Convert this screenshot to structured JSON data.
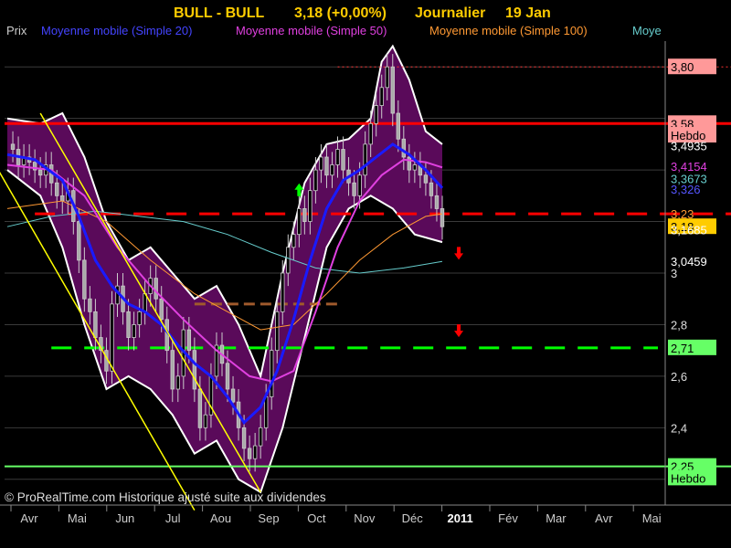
{
  "header": {
    "symbol": "BULL - BULL",
    "quote": "3,18 (+0,00%)",
    "period": "Journalier",
    "date": "19 Jan"
  },
  "legend": {
    "price": "Prix",
    "ma20": "Moyenne mobile (Simple 20)",
    "ma50": "Moyenne mobile (Simple 50)",
    "ma100": "Moyenne mobile (Simple 100)",
    "ma_cut": "Moye"
  },
  "watermark": "© ProRealTime.com Historique ajusté suite aux dividendes",
  "colors": {
    "background": "#000000",
    "band_fill": "#5a0a5a",
    "band_edge": "#ffffff",
    "ma20": "#1a1aff",
    "ma50": "#e040e0",
    "ma100": "#ff9933",
    "ma200": "#66cccc",
    "resistance": "#ff0000",
    "support": "#00ff00",
    "trendline": "#ffff00",
    "bronze": "#a05a2c"
  },
  "chart_data": {
    "type": "candlestick",
    "x_ticks": [
      "Avr",
      "Mai",
      "Jun",
      "Jul",
      "Aou",
      "Sep",
      "Oct",
      "Nov",
      "Déc",
      "2011",
      "Fév",
      "Mar",
      "Avr",
      "Mai"
    ],
    "y_ticks": [
      {
        "label": "3",
        "value": 3.0
      },
      {
        "label": "2,8",
        "value": 2.8
      },
      {
        "label": "2,6",
        "value": 2.6
      },
      {
        "label": "2,4",
        "value": 2.4
      }
    ],
    "ylim": [
      2.1,
      3.9
    ],
    "price_labels": [
      {
        "text": "3,80",
        "value": 3.8,
        "bg": "#ff9999",
        "fg": "#000000"
      },
      {
        "text": "3,58",
        "value": 3.58,
        "bg": "#ff9999",
        "fg": "#000000"
      },
      {
        "text": "Hebdo",
        "value": 3.535,
        "bg": "#ff9999",
        "fg": "#000000"
      },
      {
        "text": "3,4935",
        "value": 3.4935,
        "bg": "#000000",
        "fg": "#ffffff"
      },
      {
        "text": "3,4154",
        "value": 3.4154,
        "bg": "#000000",
        "fg": "#e040e0"
      },
      {
        "text": "3,3673",
        "value": 3.3673,
        "bg": "#000000",
        "fg": "#66cccc"
      },
      {
        "text": "3,326",
        "value": 3.326,
        "bg": "#000000",
        "fg": "#5555ff"
      },
      {
        "text": "3,23",
        "value": 3.23,
        "bg": "#000000",
        "fg": "#ff9933"
      },
      {
        "text": "3,18",
        "value": 3.18,
        "bg": "#ffcc00",
        "fg": "#000000"
      },
      {
        "text": "3,1685",
        "value": 3.1685,
        "bg": "#000000",
        "fg": "#ffffff"
      },
      {
        "text": "3,0459",
        "value": 3.0459,
        "bg": "#000000",
        "fg": "#ffffff"
      },
      {
        "text": "2,71",
        "value": 2.71,
        "bg": "#66ff66",
        "fg": "#000000"
      },
      {
        "text": "2,25",
        "value": 2.25,
        "bg": "#66ff66",
        "fg": "#000000"
      },
      {
        "text": "Hebdo",
        "value": 2.205,
        "bg": "#66ff66",
        "fg": "#000000"
      }
    ],
    "horizontal_levels": [
      {
        "name": "weekly-resistance",
        "value": 3.58,
        "style": "solid",
        "color": "#ff0000"
      },
      {
        "name": "dashed-resistance",
        "value": 3.23,
        "style": "dashed",
        "color": "#ff0000"
      },
      {
        "name": "dashed-support",
        "value": 2.71,
        "style": "dashed",
        "color": "#00ff00"
      },
      {
        "name": "weekly-support",
        "value": 2.25,
        "style": "solid",
        "color": "#66ff66"
      },
      {
        "name": "target-level",
        "value": 3.8,
        "style": "dotted",
        "color": "#ff3333"
      },
      {
        "name": "bronze-level",
        "value": 2.88,
        "style": "dashed",
        "color": "#a05a2c"
      }
    ],
    "price_series": [
      [
        0,
        3.5
      ],
      [
        1,
        3.48
      ],
      [
        2,
        3.42
      ],
      [
        3,
        3.45
      ],
      [
        4,
        3.43
      ],
      [
        5,
        3.4
      ],
      [
        6,
        3.38
      ],
      [
        7,
        3.42
      ],
      [
        8,
        3.35
      ],
      [
        9,
        3.3
      ],
      [
        10,
        3.28
      ],
      [
        11,
        3.32
      ],
      [
        12,
        3.2
      ],
      [
        13,
        3.05
      ],
      [
        14,
        2.9
      ],
      [
        15,
        2.85
      ],
      [
        16,
        2.75
      ],
      [
        17,
        2.7
      ],
      [
        18,
        2.62
      ],
      [
        19,
        2.88
      ],
      [
        20,
        2.95
      ],
      [
        21,
        2.85
      ],
      [
        22,
        2.75
      ],
      [
        23,
        2.8
      ],
      [
        24,
        2.85
      ],
      [
        25,
        2.92
      ],
      [
        26,
        2.98
      ],
      [
        27,
        2.9
      ],
      [
        28,
        2.82
      ],
      [
        29,
        2.7
      ],
      [
        30,
        2.55
      ],
      [
        31,
        2.6
      ],
      [
        32,
        2.78
      ],
      [
        33,
        2.7
      ],
      [
        34,
        2.55
      ],
      [
        35,
        2.4
      ],
      [
        36,
        2.45
      ],
      [
        37,
        2.6
      ],
      [
        38,
        2.72
      ],
      [
        39,
        2.65
      ],
      [
        40,
        2.55
      ],
      [
        41,
        2.5
      ],
      [
        42,
        2.4
      ],
      [
        43,
        2.32
      ],
      [
        44,
        2.28
      ],
      [
        45,
        2.33
      ],
      [
        46,
        2.4
      ],
      [
        47,
        2.52
      ],
      [
        48,
        2.7
      ],
      [
        49,
        2.85
      ],
      [
        50,
        3.0
      ],
      [
        51,
        3.1
      ],
      [
        52,
        3.15
      ],
      [
        53,
        3.25
      ],
      [
        54,
        3.2
      ],
      [
        55,
        3.32
      ],
      [
        56,
        3.4
      ],
      [
        57,
        3.45
      ],
      [
        58,
        3.38
      ],
      [
        59,
        3.42
      ],
      [
        60,
        3.48
      ],
      [
        61,
        3.4
      ],
      [
        62,
        3.35
      ],
      [
        63,
        3.3
      ],
      [
        64,
        3.38
      ],
      [
        65,
        3.5
      ],
      [
        66,
        3.58
      ],
      [
        67,
        3.65
      ],
      [
        68,
        3.72
      ],
      [
        69,
        3.8
      ],
      [
        70,
        3.62
      ],
      [
        71,
        3.52
      ],
      [
        72,
        3.45
      ],
      [
        73,
        3.4
      ],
      [
        74,
        3.42
      ],
      [
        75,
        3.38
      ],
      [
        76,
        3.35
      ],
      [
        77,
        3.3
      ],
      [
        78,
        3.25
      ],
      [
        79,
        3.18
      ]
    ],
    "ma20": [
      [
        0,
        3.46
      ],
      [
        5,
        3.44
      ],
      [
        10,
        3.36
      ],
      [
        13,
        3.22
      ],
      [
        16,
        3.05
      ],
      [
        19,
        2.95
      ],
      [
        22,
        2.88
      ],
      [
        25,
        2.85
      ],
      [
        28,
        2.8
      ],
      [
        31,
        2.72
      ],
      [
        34,
        2.65
      ],
      [
        37,
        2.6
      ],
      [
        40,
        2.52
      ],
      [
        43,
        2.42
      ],
      [
        46,
        2.48
      ],
      [
        49,
        2.62
      ],
      [
        52,
        2.82
      ],
      [
        55,
        3.05
      ],
      [
        58,
        3.25
      ],
      [
        61,
        3.36
      ],
      [
        64,
        3.4
      ],
      [
        67,
        3.45
      ],
      [
        70,
        3.5
      ],
      [
        73,
        3.46
      ],
      [
        76,
        3.4
      ],
      [
        79,
        3.33
      ]
    ],
    "ma50": [
      [
        0,
        3.42
      ],
      [
        8,
        3.4
      ],
      [
        14,
        3.3
      ],
      [
        20,
        3.1
      ],
      [
        26,
        2.95
      ],
      [
        32,
        2.82
      ],
      [
        38,
        2.7
      ],
      [
        44,
        2.6
      ],
      [
        48,
        2.58
      ],
      [
        52,
        2.62
      ],
      [
        56,
        2.85
      ],
      [
        60,
        3.1
      ],
      [
        64,
        3.28
      ],
      [
        68,
        3.38
      ],
      [
        72,
        3.44
      ],
      [
        76,
        3.43
      ],
      [
        79,
        3.41
      ]
    ],
    "ma100": [
      [
        0,
        3.25
      ],
      [
        10,
        3.28
      ],
      [
        18,
        3.2
      ],
      [
        26,
        3.05
      ],
      [
        34,
        2.92
      ],
      [
        40,
        2.85
      ],
      [
        46,
        2.78
      ],
      [
        52,
        2.8
      ],
      [
        58,
        2.92
      ],
      [
        64,
        3.05
      ],
      [
        70,
        3.15
      ],
      [
        76,
        3.22
      ],
      [
        79,
        3.23
      ]
    ],
    "ma200": [
      [
        0,
        3.18
      ],
      [
        8,
        3.22
      ],
      [
        16,
        3.24
      ],
      [
        24,
        3.22
      ],
      [
        32,
        3.2
      ],
      [
        40,
        3.15
      ],
      [
        48,
        3.08
      ],
      [
        56,
        3.02
      ],
      [
        64,
        3.0
      ],
      [
        72,
        3.02
      ],
      [
        79,
        3.045
      ]
    ],
    "band_upper": [
      [
        0,
        3.6
      ],
      [
        6,
        3.58
      ],
      [
        10,
        3.62
      ],
      [
        14,
        3.45
      ],
      [
        18,
        3.2
      ],
      [
        22,
        3.05
      ],
      [
        26,
        3.1
      ],
      [
        30,
        3.0
      ],
      [
        34,
        2.9
      ],
      [
        38,
        2.95
      ],
      [
        42,
        2.8
      ],
      [
        46,
        2.6
      ],
      [
        50,
        3.0
      ],
      [
        54,
        3.35
      ],
      [
        58,
        3.5
      ],
      [
        62,
        3.52
      ],
      [
        66,
        3.6
      ],
      [
        68,
        3.82
      ],
      [
        70,
        3.88
      ],
      [
        73,
        3.75
      ],
      [
        76,
        3.55
      ],
      [
        79,
        3.5
      ]
    ],
    "band_lower": [
      [
        0,
        3.4
      ],
      [
        6,
        3.3
      ],
      [
        10,
        3.1
      ],
      [
        14,
        2.8
      ],
      [
        18,
        2.55
      ],
      [
        22,
        2.6
      ],
      [
        26,
        2.55
      ],
      [
        30,
        2.45
      ],
      [
        34,
        2.3
      ],
      [
        38,
        2.35
      ],
      [
        42,
        2.2
      ],
      [
        46,
        2.15
      ],
      [
        50,
        2.4
      ],
      [
        54,
        2.75
      ],
      [
        58,
        3.1
      ],
      [
        62,
        3.25
      ],
      [
        66,
        3.3
      ],
      [
        70,
        3.25
      ],
      [
        74,
        3.15
      ],
      [
        79,
        3.12
      ]
    ],
    "trendlines": [
      {
        "name": "upper-trendline",
        "from": [
          6,
          3.62
        ],
        "to": [
          46,
          2.15
        ]
      },
      {
        "name": "lower-trendline",
        "from": [
          -3,
          3.45
        ],
        "to": [
          34,
          2.08
        ]
      }
    ],
    "signals": [
      {
        "name": "buy-arrow",
        "x": 53,
        "value": 3.32,
        "dir": "up",
        "color": "#00ff00"
      },
      {
        "name": "sell-arrow-1",
        "x": 82,
        "value": 3.08,
        "dir": "down",
        "color": "#ff0000"
      },
      {
        "name": "sell-arrow-2",
        "x": 82,
        "value": 2.78,
        "dir": "down",
        "color": "#ff0000"
      }
    ]
  }
}
